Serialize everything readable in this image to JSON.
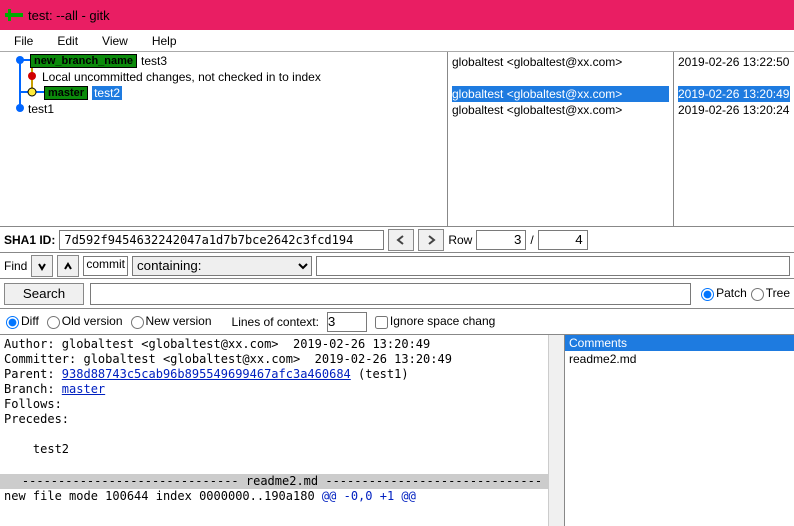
{
  "window": {
    "title": "test: --all - gitk"
  },
  "menu": {
    "file": "File",
    "edit": "Edit",
    "view": "View",
    "help": "Help"
  },
  "commits": [
    {
      "branch": "new_branch_name",
      "msg": "test3",
      "author": "globaltest <globaltest@xx.com>",
      "date": "2019-02-26 13:22:50",
      "sel": false
    },
    {
      "branch": "",
      "msg": "Local uncommitted changes, not checked in to index",
      "author": "",
      "date": "",
      "sel": false
    },
    {
      "branch": "master",
      "msg": "test2",
      "author": "globaltest <globaltest@xx.com>",
      "date": "2019-02-26 13:20:49",
      "sel": true
    },
    {
      "branch": "",
      "msg": "test1",
      "author": "globaltest <globaltest@xx.com>",
      "date": "2019-02-26 13:20:24",
      "sel": false
    }
  ],
  "sha": {
    "label": "SHA1 ID:",
    "value": "7d592f9454632242047a1d7b7bce2642c3fcd194",
    "row_label": "Row",
    "row_cur": "3",
    "row_sep": "/",
    "row_total": "4"
  },
  "find": {
    "label": "Find",
    "type": "commit",
    "mode": "containing:"
  },
  "search": {
    "button": "Search",
    "patch": "Patch",
    "tree": "Tree"
  },
  "opts": {
    "diff": "Diff",
    "old": "Old version",
    "new": "New version",
    "lines_label": "Lines of context:",
    "lines_val": "3",
    "ignore": "Ignore space chang"
  },
  "detail": {
    "author_lbl": "Author: ",
    "author_val": "globaltest <globaltest@xx.com>  2019-02-26 13:20:49",
    "committer_lbl": "Committer: ",
    "committer_val": "globaltest <globaltest@xx.com>  2019-02-26 13:20:49",
    "parent_lbl": "Parent: ",
    "parent_hash": "938d88743c5cab96b895549699467afc3a460684",
    "parent_msg": " (test1)",
    "branch_lbl": "Branch: ",
    "branch_val": "master",
    "follows": "Follows:",
    "precedes": "Precedes:",
    "commit_msg": "    test2",
    "diff_sep": "------------------------------ readme2.md ------------------------------",
    "diff_l1": "new file mode 100644",
    "diff_l2": "index 0000000..190a180",
    "diff_l3": "@@ -0,0 +1 @@"
  },
  "files": {
    "header": "Comments",
    "item": "readme2.md"
  }
}
